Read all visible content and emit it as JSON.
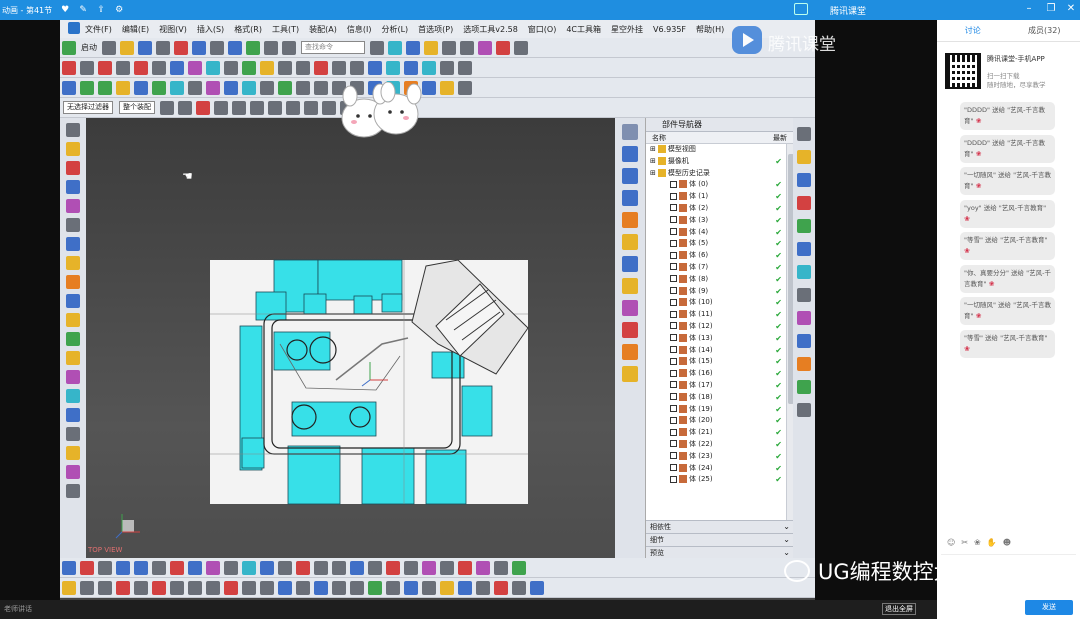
{
  "host": {
    "title": "动画 - 第41节",
    "live_text": "腾讯课堂"
  },
  "nx": {
    "menu": [
      "文件(F)",
      "编辑(E)",
      "视图(V)",
      "插入(S)",
      "格式(R)",
      "工具(T)",
      "装配(A)",
      "信息(I)",
      "分析(L)",
      "首选项(P)",
      "选项工具v2.58",
      "窗口(O)",
      "4C工具箱",
      "星空外挂",
      "V6.935F",
      "帮助(H)"
    ],
    "start_label": "启动",
    "search_placeholder": "查找命令",
    "filter_select": "无选择过滤器",
    "assembly_select": "整个装配",
    "view_label": "TOP VIEW",
    "tencent_watermark": "腾讯课堂",
    "navigator": {
      "title": "部件导航器",
      "col_name": "名称",
      "col_latest": "最新",
      "model_views": "模型视图",
      "camera": "摄像机",
      "history": "模型历史记录",
      "bodies": [
        "体 (0)",
        "体 (1)",
        "体 (2)",
        "体 (3)",
        "体 (4)",
        "体 (5)",
        "体 (6)",
        "体 (7)",
        "体 (8)",
        "体 (9)",
        "体 (10)",
        "体 (11)",
        "体 (12)",
        "体 (13)",
        "体 (14)",
        "体 (15)",
        "体 (16)",
        "体 (17)",
        "体 (18)",
        "体 (19)",
        "体 (20)",
        "体 (21)",
        "体 (22)",
        "体 (23)",
        "体 (24)",
        "体 (25)"
      ],
      "sections": [
        "相依性",
        "细节",
        "预览"
      ]
    }
  },
  "chat": {
    "tab_discuss": "讨论",
    "tab_members": "成员(32)",
    "qr_title": "腾讯课堂-手机APP",
    "qr_sub1": "扫一扫下载",
    "qr_sub2": "随时随地，尽享教学",
    "messages": [
      "\"DDDD\" 送给 \"艺风-千言教育\"",
      "\"DDDD\" 送给 \"艺风-千言教育\"",
      "\"一切随风\" 送给 \"艺风-千言教育\"",
      "\"yoy\" 送给 \"艺风-千言教育\"",
      "\"等雪\" 送给 \"艺风-千言教育\"",
      "\"你、真要分分\" 送给 \"艺风-千言教育\"",
      "\"一切随风\" 送给 \"艺风-千言教育\"",
      "\"等雪\" 送给 \"艺风-千言教育\""
    ],
    "send": "发送"
  },
  "bottom": {
    "teacher_label": "老师讲话",
    "fullscreen": "退出全屏"
  },
  "watermark": "UG编程数控大表弟",
  "colors": {
    "host_blue": "#1f8ee0",
    "cyan_part": "#37e0e8",
    "chat_blue": "#1e88e5"
  }
}
